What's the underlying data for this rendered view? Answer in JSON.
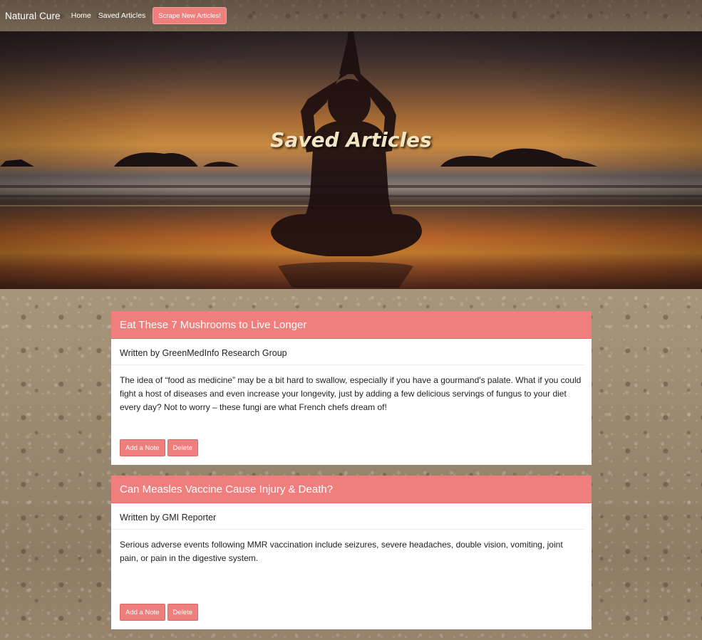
{
  "navbar": {
    "brand": "Natural Cure",
    "links": [
      "Home",
      "Saved Articles"
    ],
    "scrape_label": "Scrape New Articles!"
  },
  "hero": {
    "title": "Saved Articles"
  },
  "colors": {
    "accent": "#ef7f7d"
  },
  "articles": [
    {
      "title": "Eat These 7 Mushrooms to Live Longer",
      "author": "Written by GreenMedInfo Research Group",
      "summary": "The idea of “food as medicine” may be a bit hard to swallow, especially if you have a gourmand's palate. What if you could fight a host of diseases and even increase your longevity, just by adding a few delicious servings of fungus to your diet every day? Not to worry – these fungi are what French chefs dream of!",
      "add_note_label": "Add a Note",
      "delete_label": "Delete"
    },
    {
      "title": "Can Measles Vaccine Cause Injury & Death?",
      "author": "Written by GMI Reporter",
      "summary": "Serious adverse events following MMR vaccination include seizures, severe headaches, double vision, vomiting, joint pain, or pain in the digestive system.",
      "add_note_label": "Add a Note",
      "delete_label": "Delete"
    }
  ]
}
